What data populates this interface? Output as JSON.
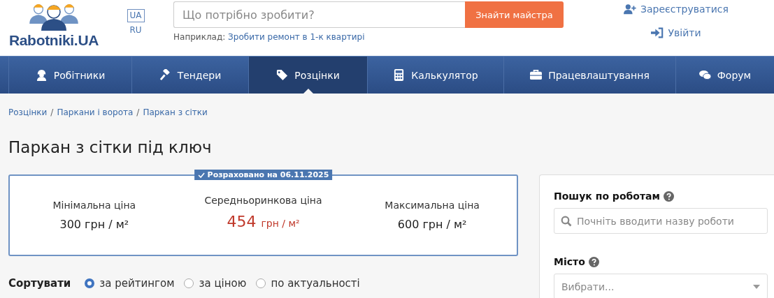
{
  "logo": {
    "text": "Rabotniki.UA"
  },
  "languages": [
    {
      "label": "UA",
      "selected": true
    },
    {
      "label": "RU",
      "selected": false
    }
  ],
  "search": {
    "placeholder": "Що потрібно зробити?",
    "button": "Знайти майстра",
    "hint_label": "Наприклад:",
    "hint_link": "Зробити ремонт в 1-к квартирі"
  },
  "auth": [
    {
      "kind": "register",
      "label": "Зареєструватися"
    },
    {
      "kind": "login",
      "label": "Увійти"
    }
  ],
  "nav": [
    {
      "kind": "workers",
      "label": "Робітники",
      "selected": false
    },
    {
      "kind": "tenders",
      "label": "Тендери",
      "selected": false
    },
    {
      "kind": "prices",
      "label": "Розцінки",
      "selected": true
    },
    {
      "kind": "calculator",
      "label": "Калькулятор",
      "selected": false
    },
    {
      "kind": "jobs",
      "label": "Працевлаштування",
      "selected": false
    },
    {
      "kind": "forum",
      "label": "Форум",
      "selected": false
    }
  ],
  "breadcrumbs": {
    "separator": "/",
    "items": [
      "Розцінки",
      "Паркани і ворота",
      "Паркан з сітки"
    ]
  },
  "title": "Паркан з сітки під ключ",
  "price_card": {
    "badge": "Розраховано на 06.11.2025",
    "prices": [
      {
        "kind": "min",
        "label": "Мінімальна ціна",
        "value": "300",
        "unit": "грн / м²"
      },
      {
        "kind": "avg",
        "label": "Середньоринкова ціна",
        "value": "454",
        "unit": "грн / м²"
      },
      {
        "kind": "max",
        "label": "Максимальна ціна",
        "value": "600",
        "unit": "грн / м²"
      }
    ]
  },
  "sort": {
    "label": "Сортувати",
    "options": [
      {
        "label": "за рейтингом",
        "selected": true
      },
      {
        "label": "за ціною",
        "selected": false
      },
      {
        "label": "по актуальності",
        "selected": false
      }
    ]
  },
  "sidebar": {
    "work_search": {
      "label": "Пошук по роботам",
      "placeholder": "Почніть вводити назву роботи"
    },
    "city": {
      "label": "Місто",
      "placeholder": "Вибрати..."
    }
  }
}
